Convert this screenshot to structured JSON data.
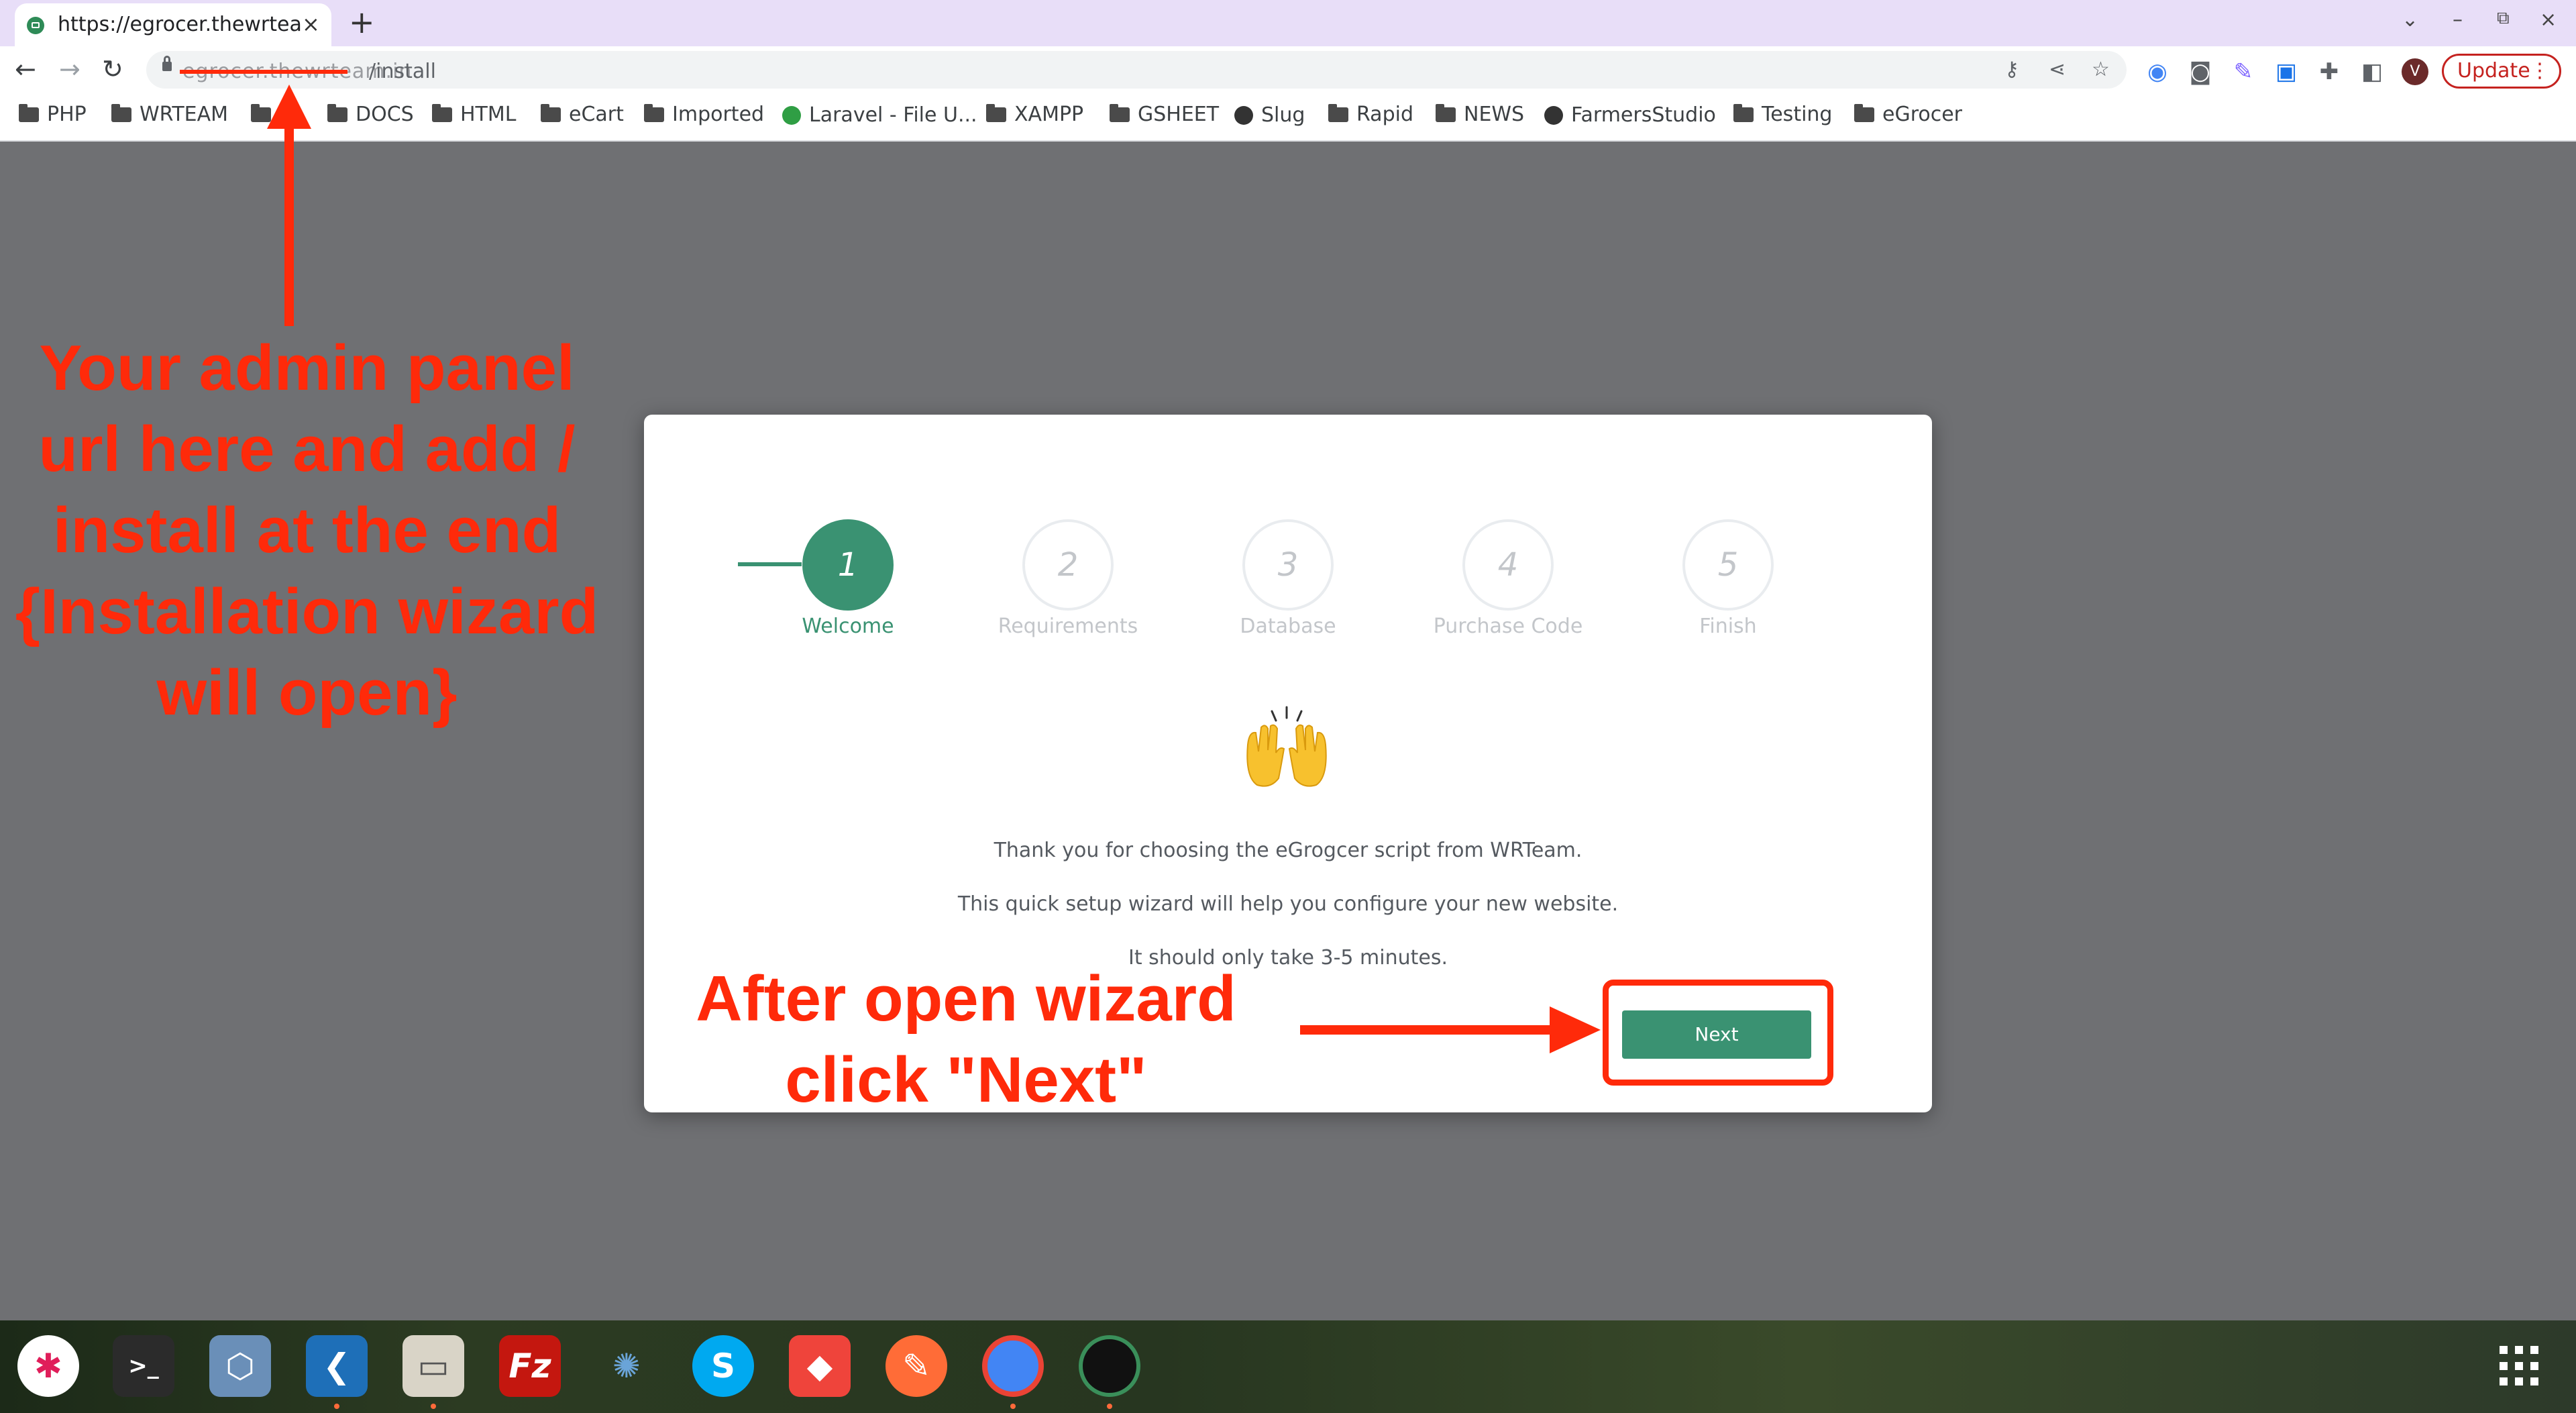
{
  "browser": {
    "tab_title": "https://egrocer.thewrtea",
    "tab_close": "×",
    "new_tab": "+",
    "url_hidden": "egrocer.thewrteam.in",
    "url_path": "/install",
    "update_label": "Update",
    "profile_initial": "V"
  },
  "bookmarks": [
    {
      "label": "PHP",
      "icon": "folder"
    },
    {
      "label": "WRTEAM",
      "icon": "folder"
    },
    {
      "label": "",
      "icon": "folder"
    },
    {
      "label": "DOCS",
      "icon": "folder"
    },
    {
      "label": "HTML",
      "icon": "folder"
    },
    {
      "label": "eCart",
      "icon": "folder"
    },
    {
      "label": "Imported",
      "icon": "folder"
    },
    {
      "label": "Laravel - File U...",
      "icon": "green-leaf"
    },
    {
      "label": "XAMPP",
      "icon": "folder"
    },
    {
      "label": "GSHEET",
      "icon": "folder"
    },
    {
      "label": "Slug",
      "icon": "globe"
    },
    {
      "label": "Rapid",
      "icon": "folder"
    },
    {
      "label": "NEWS",
      "icon": "folder"
    },
    {
      "label": "FarmersStudio",
      "icon": "globe"
    },
    {
      "label": "Testing",
      "icon": "folder"
    },
    {
      "label": "eGrocer",
      "icon": "folder"
    }
  ],
  "wizard": {
    "steps": [
      {
        "number": "1",
        "label": "Welcome",
        "active": true
      },
      {
        "number": "2",
        "label": "Requirements",
        "active": false
      },
      {
        "number": "3",
        "label": "Database",
        "active": false
      },
      {
        "number": "4",
        "label": "Purchase Code",
        "active": false
      },
      {
        "number": "5",
        "label": "Finish",
        "active": false
      }
    ],
    "emoji": "raising-hands",
    "messages": [
      "Thank you for choosing the eGrogcer script from WRTeam.",
      "This quick setup wizard will help you configure your new website.",
      "It should only take 3-5 minutes."
    ],
    "next_label": "Next"
  },
  "annotations": {
    "url_note_lines": [
      "Your admin panel",
      "url here and add /",
      "install at the end",
      "{Installation wizard",
      "will open}"
    ],
    "next_note_lines": [
      "After open wizard",
      "click \"Next\""
    ],
    "color": "#ff2a0a"
  },
  "colors": {
    "accent": "#3a9272",
    "tabbar": "#e8def8",
    "overlay": "#6f7073"
  },
  "taskbar": [
    {
      "name": "slack-icon"
    },
    {
      "name": "terminal-icon"
    },
    {
      "name": "virtualbox-icon"
    },
    {
      "name": "vscode-icon"
    },
    {
      "name": "files-icon"
    },
    {
      "name": "filezilla-icon"
    },
    {
      "name": "shutter-icon"
    },
    {
      "name": "skype-icon"
    },
    {
      "name": "anydesk-icon"
    },
    {
      "name": "postman-icon"
    },
    {
      "name": "chrome-icon"
    },
    {
      "name": "webcam-icon"
    }
  ]
}
